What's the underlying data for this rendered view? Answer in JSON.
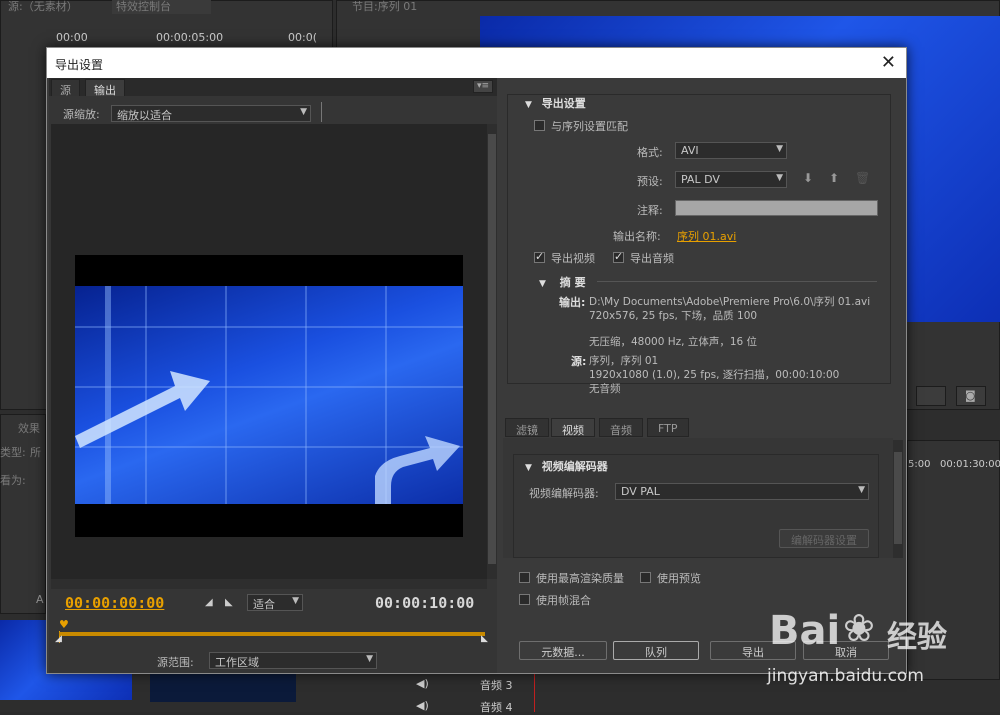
{
  "background": {
    "source_tab": "源:（无素材）",
    "effect_tab": "特效控制台",
    "program_tab": "节目:序列 01",
    "tc_start": "00:00",
    "tc_mid": "00:00:05:00",
    "tc_mid2": "00:0(",
    "effects_tab": "效果",
    "type_label": "类型:",
    "type_value": "所",
    "view_label": "看为:",
    "timeline_tc1": "5:00",
    "timeline_tc2": "00:01:30:00",
    "audio3": "音频 3",
    "audio4": "音频 4",
    "a_label": "A"
  },
  "dialog": {
    "title": "导出设置",
    "close": "✕",
    "left": {
      "tab_source": "源",
      "tab_output": "输出",
      "menu": "▾≡",
      "scale_label": "源缩放:",
      "scale_value": "缩放以适合",
      "timecode_current": "00:00:00:00",
      "fit_value": "适合",
      "timecode_end": "00:00:10:00",
      "range_label": "源范围:",
      "range_value": "工作区域"
    },
    "right": {
      "export_settings_head": "导出设置",
      "match_sequence": "与序列设置匹配",
      "format_label": "格式:",
      "format_value": "AVI",
      "preset_label": "预设:",
      "preset_value": "PAL DV",
      "comment_label": "注释:",
      "output_name_label": "输出名称:",
      "output_name_value": "序列 01.avi",
      "export_video": "导出视频",
      "export_audio": "导出音频",
      "summary_head": "摘 要",
      "output_key": "输出:",
      "output_line1": "D:\\My Documents\\Adobe\\Premiere Pro\\6.0\\序列 01.avi",
      "output_line2": "720x576, 25 fps, 下场，品质 100",
      "output_line3": "无压缩，48000 Hz, 立体声，16 位",
      "source_key": "源:",
      "source_line1": "序列，序列 01",
      "source_line2": "1920x1080 (1.0), 25 fps, 逐行扫描，00:00:10:00",
      "source_line3": "无音频",
      "subtabs": [
        "滤镜",
        "视频",
        "音频",
        "FTP"
      ],
      "codec_head": "视频编解码器",
      "codec_label": "视频编解码器:",
      "codec_value": "DV PAL",
      "codec_settings": "编解码器设置",
      "max_render": "使用最高渲染质量",
      "use_preview": "使用预览",
      "frame_blend": "使用帧混合",
      "metadata_btn": "元数据...",
      "queue_btn": "队列",
      "export_btn": "导出",
      "cancel_btn": "取消"
    }
  },
  "watermark": {
    "brand": "Bai",
    "brand2": "经验",
    "url": "jingyan.baidu.com"
  }
}
